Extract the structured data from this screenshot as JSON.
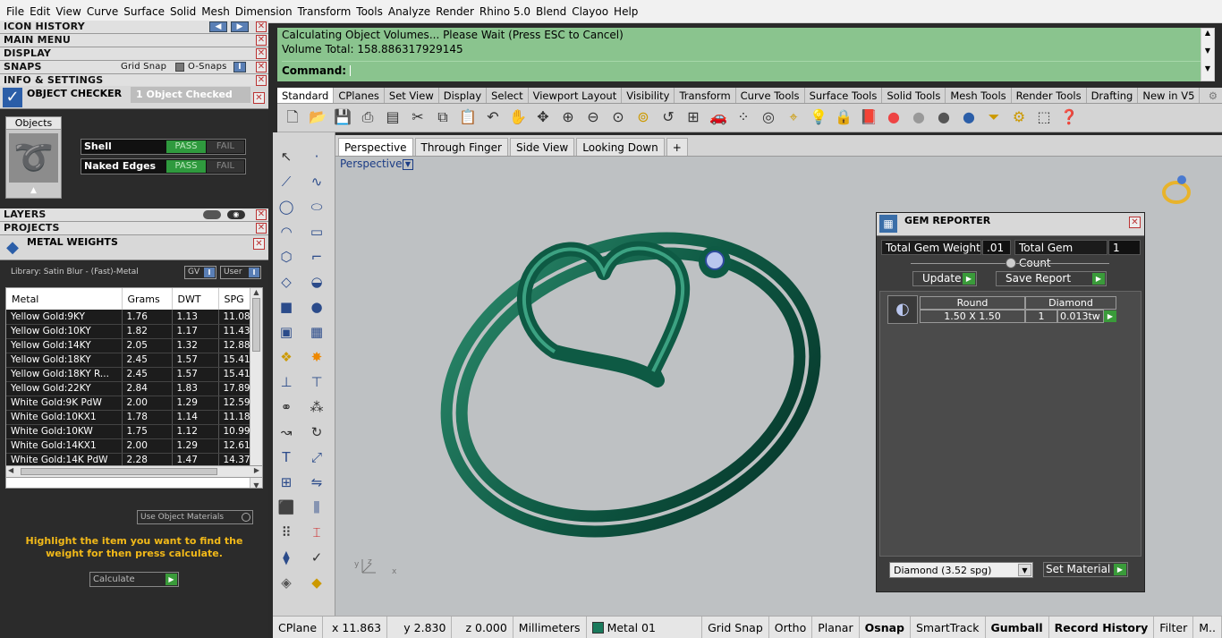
{
  "menubar": [
    "File",
    "Edit",
    "View",
    "Curve",
    "Surface",
    "Solid",
    "Mesh",
    "Dimension",
    "Transform",
    "Tools",
    "Analyze",
    "Render",
    "Rhino 5.0",
    "Blend",
    "Clayoo",
    "Help"
  ],
  "panels": {
    "icon_history": "ICON HISTORY",
    "main_menu": "MAIN MENU",
    "display": "DISPLAY",
    "snaps": "SNAPS",
    "grid_snap": "Grid Snap",
    "o_snaps": "O-Snaps",
    "info": "INFO & SETTINGS",
    "layers": "LAYERS",
    "projects": "PROJECTS"
  },
  "object_checker": {
    "title": "OBJECT CHECKER",
    "status": "1  Object Checked",
    "objects_label": "Objects",
    "rows": [
      {
        "name": "Shell",
        "pass": "PASS",
        "fail": "FAIL"
      },
      {
        "name": "Naked Edges",
        "pass": "PASS",
        "fail": "FAIL"
      }
    ]
  },
  "metal_weights": {
    "title": "METAL WEIGHTS",
    "library": "Library: Satin Blur - (Fast)-Metal",
    "gv": "GV",
    "user": "User",
    "columns": [
      "Metal",
      "Grams",
      "DWT",
      "SPG"
    ],
    "rows": [
      [
        "Yellow Gold:9KY",
        "1.76",
        "1.13",
        "11.08"
      ],
      [
        "Yellow Gold:10KY",
        "1.82",
        "1.17",
        "11.43"
      ],
      [
        "Yellow Gold:14KY",
        "2.05",
        "1.32",
        "12.88"
      ],
      [
        "Yellow Gold:18KY",
        "2.45",
        "1.57",
        "15.41"
      ],
      [
        "Yellow Gold:18KY R...",
        "2.45",
        "1.57",
        "15.41"
      ],
      [
        "Yellow Gold:22KY",
        "2.84",
        "1.83",
        "17.89"
      ],
      [
        "White Gold:9K PdW",
        "2.00",
        "1.29",
        "12.59"
      ],
      [
        "White Gold:10KX1",
        "1.78",
        "1.14",
        "11.18"
      ],
      [
        "White Gold:10KW",
        "1.75",
        "1.12",
        "10.99"
      ],
      [
        "White Gold:14KX1",
        "2.00",
        "1.29",
        "12.61"
      ],
      [
        "White Gold:14K PdW",
        "2.28",
        "1.47",
        "14.37"
      ]
    ],
    "use_object_materials": "Use Object Materials",
    "hint": "Highlight the item you want to find the weight for then press calculate.",
    "calculate": "Calculate"
  },
  "command": {
    "line1": "Calculating Object Volumes... Please Wait (Press ESC to Cancel)",
    "line2": "Volume Total: 158.886317929145",
    "prompt": "Command:"
  },
  "tabs": [
    "Standard",
    "CPlanes",
    "Set View",
    "Display",
    "Select",
    "Viewport Layout",
    "Visibility",
    "Transform",
    "Curve Tools",
    "Surface Tools",
    "Solid Tools",
    "Mesh Tools",
    "Render Tools",
    "Drafting",
    "New in V5"
  ],
  "viewport_tabs": [
    "Perspective",
    "Through Finger",
    "Side View",
    "Looking Down",
    "+"
  ],
  "viewport_label": "Perspective",
  "gem_reporter": {
    "title": "GEM REPORTER",
    "total_weight_label": "Total Gem Weight",
    "total_weight": ".01",
    "total_count_label": "Total Gem Count",
    "total_count": "1",
    "update": "Update",
    "save_report": "Save Report",
    "gem_shape": "Round",
    "gem_type": "Diamond",
    "gem_size": "1.50 X 1.50",
    "gem_qty": "1",
    "gem_weight": "0.013tw",
    "material": "Diamond      (3.52 spg)",
    "set_material": "Set Material"
  },
  "statusbar": {
    "cplane": "CPlane",
    "x": "x 11.863",
    "y": "y 2.830",
    "z": "z 0.000",
    "units": "Millimeters",
    "layer": "Metal 01",
    "toggles": [
      "Grid Snap",
      "Ortho",
      "Planar",
      "Osnap",
      "SmartTrack",
      "Gumball",
      "Record History",
      "Filter",
      "M.."
    ]
  },
  "colors": {
    "ring": "#1a6b54",
    "command_bg": "#8ac48e",
    "pass": "#2f9a3e",
    "accent": "#5a7fb5"
  }
}
